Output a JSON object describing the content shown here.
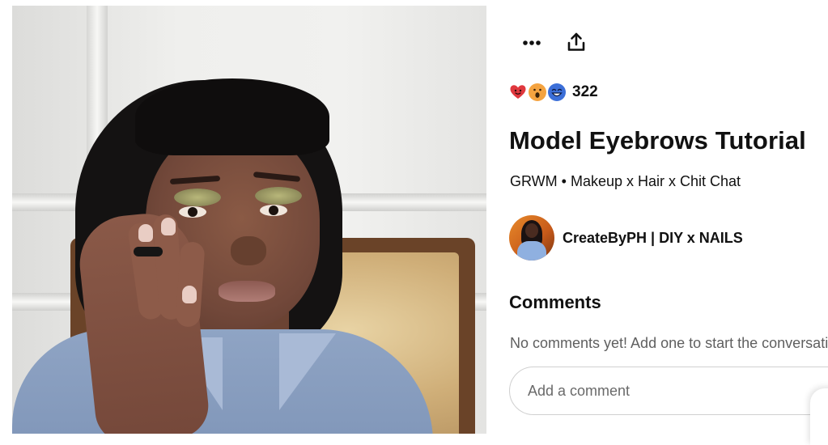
{
  "header": {
    "more_icon": "more-horizontal-icon",
    "share_icon": "share-icon"
  },
  "reactions": {
    "emojis": [
      "❤",
      "😮",
      "😄"
    ],
    "count": "322"
  },
  "pin": {
    "title": "Model Eyebrows Tutorial",
    "subtitle": "GRWM • Makeup x Hair x Chit Chat"
  },
  "creator": {
    "name": "CreateByPH | DIY x NAILS"
  },
  "comments": {
    "heading": "Comments",
    "empty_text": "No comments yet! Add one to start the conversation.",
    "input_placeholder": "Add a comment"
  },
  "colors": {
    "text": "#111111",
    "muted": "#5f5f5f",
    "border": "#d0d0d0",
    "heart": "#e0383e",
    "wow": "#f4a340",
    "smile": "#3c6fd8"
  }
}
